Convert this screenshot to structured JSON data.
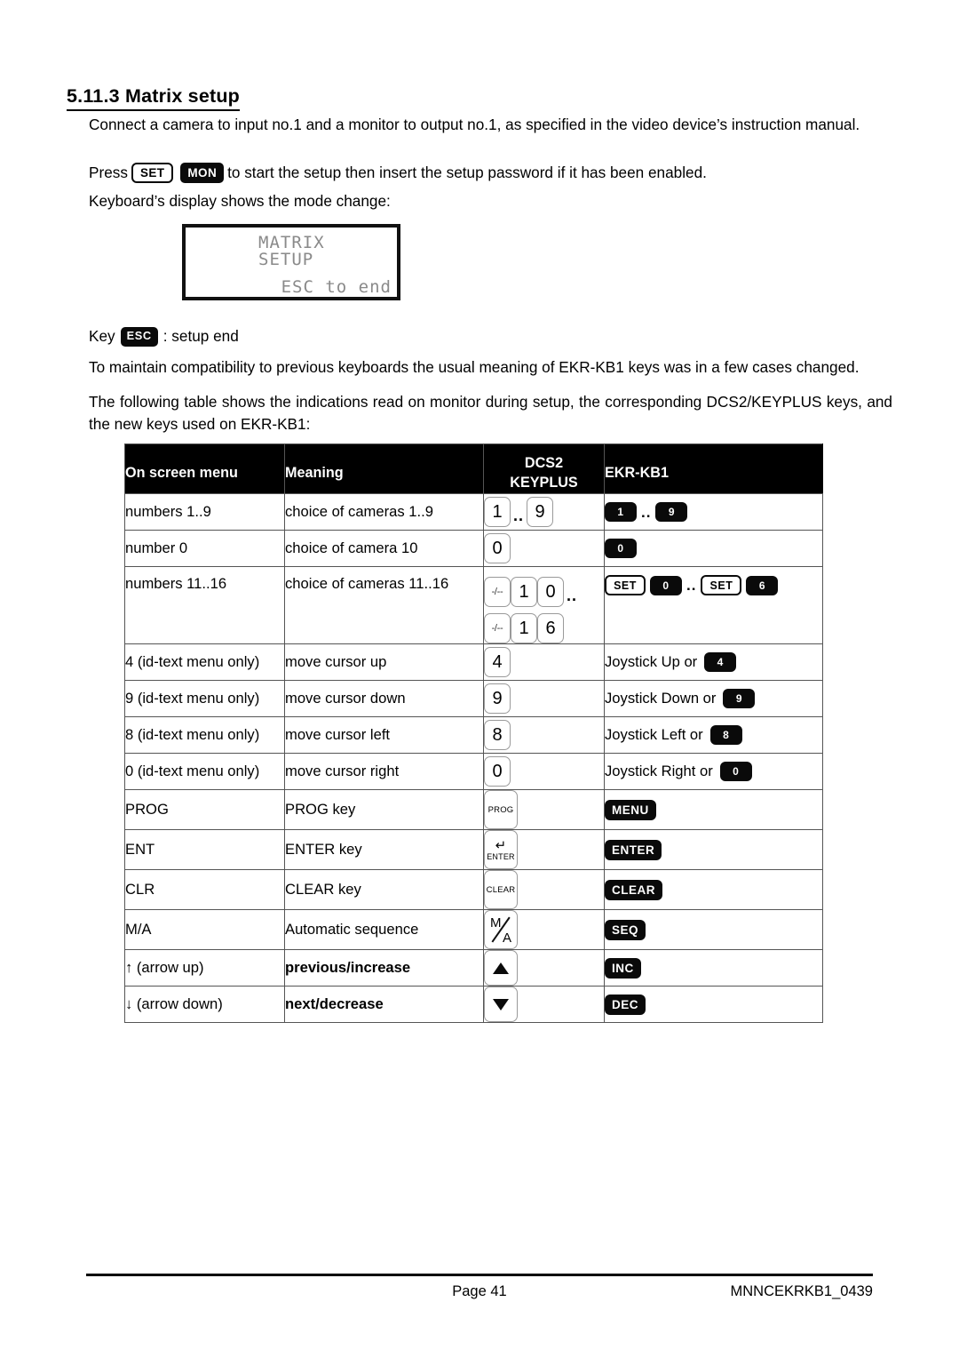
{
  "heading": "5.11.3 Matrix setup",
  "paragraphs": {
    "intro": "Connect a camera to input no.1 and a monitor to output no.1, as specified in the video device’s instruction manual.",
    "press_prefix": "Press",
    "press_suffix": "to start the setup then insert the setup password if it has been enabled.",
    "display_note": "Keyboard’s display shows the mode change:",
    "key_prefix": "Key",
    "key_suffix": ": setup end",
    "compat": "To maintain compatibility to previous keyboards the usual meaning of EKR-KB1 keys was in a few cases changed.",
    "table_intro": "The following table shows the indications read on monitor during setup, the corresponding DCS2/KEYPLUS keys, and the new keys used on EKR-KB1:"
  },
  "inline_keys": {
    "set": "SET",
    "mon": "MON",
    "esc": "ESC"
  },
  "lcd": {
    "line1": "MATRIX",
    "line2": "SETUP",
    "line3": "ESC to end"
  },
  "table": {
    "headers": {
      "col1": "On screen menu",
      "col2": "Meaning",
      "col3_line1": "DCS2",
      "col3_line2": "KEYPLUS",
      "col4": "EKR-KB1"
    },
    "rows": [
      {
        "menu": "numbers 1..9",
        "meaning": "choice of cameras 1..9",
        "dcs2_keys": [
          "1",
          "9"
        ],
        "dcs2_separator": "..",
        "ekr_keys": [
          "1",
          "9"
        ],
        "ekr_separator": ".."
      },
      {
        "menu": "number 0",
        "meaning": "choice of camera 10",
        "dcs2_keys": [
          "0"
        ],
        "ekr_keys": [
          "0"
        ]
      },
      {
        "menu": "numbers 11..16",
        "meaning": "choice of cameras 11..16",
        "dcs2_row1": [
          "-/--",
          "1",
          "0"
        ],
        "dcs2_row2": [
          "-/--",
          "1",
          "6"
        ],
        "dcs2_separator": "..",
        "ekr_set": "SET",
        "ekr_first_digit": "0",
        "ekr_second_digit": "6",
        "ekr_separator": ".."
      },
      {
        "menu": "4 (id-text menu only)",
        "meaning": "move cursor up",
        "dcs2_keys": [
          "4"
        ],
        "ekr_prefix": "Joystick Up or",
        "ekr_keys": [
          "4"
        ]
      },
      {
        "menu": "9 (id-text menu only)",
        "meaning": "move cursor down",
        "dcs2_keys": [
          "9"
        ],
        "ekr_prefix": "Joystick Down or",
        "ekr_keys": [
          "9"
        ]
      },
      {
        "menu": "8 (id-text menu only)",
        "meaning": "move cursor left",
        "dcs2_keys": [
          "8"
        ],
        "ekr_prefix": "Joystick Left or",
        "ekr_keys": [
          "8"
        ]
      },
      {
        "menu": "0 (id-text menu only)",
        "meaning": "move cursor right",
        "dcs2_keys": [
          "0"
        ],
        "ekr_prefix": "Joystick Right or",
        "ekr_keys": [
          "0"
        ]
      },
      {
        "menu": "PROG",
        "meaning": "PROG key",
        "dcs2_label": "PROG",
        "ekr_label": "MENU"
      },
      {
        "menu": "ENT",
        "meaning": "ENTER key",
        "dcs2_label": "ENTER",
        "dcs2_glyph": "↵",
        "ekr_label": "ENTER"
      },
      {
        "menu": "CLR",
        "meaning": "CLEAR key",
        "dcs2_label": "CLEAR",
        "ekr_label": "CLEAR"
      },
      {
        "menu": "M/A",
        "meaning": "Automatic sequence",
        "dcs2_top": "M",
        "dcs2_bottom": "A",
        "ekr_label": "SEQ"
      },
      {
        "menu": "↑ (arrow up)",
        "meaning": "previous/increase",
        "meaning_bold": true,
        "dcs2_arrow": "up",
        "ekr_label": "INC"
      },
      {
        "menu": "↓ (arrow down)",
        "meaning": "next/decrease",
        "meaning_bold": true,
        "dcs2_arrow": "down",
        "ekr_label": "DEC"
      }
    ]
  },
  "footer": {
    "page": "Page 41",
    "code": "MNNCEKRKB1_0439"
  },
  "colors": {
    "key_dark": "#0a0a0a",
    "key_text_light": "#ffffff",
    "header_bg": "#000000",
    "lcd_text": "#8a8a8a",
    "border": "#555555"
  }
}
